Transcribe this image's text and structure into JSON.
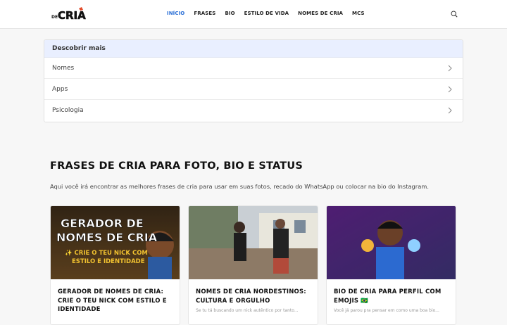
{
  "header": {
    "logo_text": "CRIA",
    "logo_prefix": "DE",
    "nav": [
      {
        "label": "INÍCIO",
        "active": true
      },
      {
        "label": "FRASES",
        "active": false
      },
      {
        "label": "BIO",
        "active": false
      },
      {
        "label": "ESTILO DE VIDA",
        "active": false
      },
      {
        "label": "NOMES DE CRIA",
        "active": false
      },
      {
        "label": "MCS",
        "active": false
      }
    ],
    "search_icon": "search-icon"
  },
  "discover": {
    "heading": "Descobrir mais",
    "items": [
      {
        "label": "Nomes"
      },
      {
        "label": "Apps"
      },
      {
        "label": "Psicologia"
      }
    ]
  },
  "main": {
    "title": "FRASES DE CRIA PARA FOTO, BIO E STATUS",
    "intro": "Aqui você irá encontrar as melhores frases de cria para usar em suas fotos, recado do WhatsApp ou colocar na bio do Instagram."
  },
  "posts": [
    {
      "title": "GERADOR DE NOMES DE CRIA: CRIE O TEU NICK COM ESTILO E IDENTIDADE",
      "thumb_line1": "GERADOR DE",
      "thumb_line2": "NOMES DE CRIA",
      "thumb_line3": "✨ CRIE O TEU NICK COM",
      "thumb_line4": "ESTILO E IDENTIDADE",
      "excerpt": ""
    },
    {
      "title": "NOMES DE CRIA NORDESTINOS: CULTURA E ORGULHO",
      "excerpt": "Se tu tá buscando um nick autêntico por tanto..."
    },
    {
      "title": "BIO DE CRIA PARA PERFIL COM EMOJIS 🇧🇷",
      "excerpt": "Você já parou pra pensar em como uma boa bio..."
    }
  ],
  "colors": {
    "accent": "#2a6fd6",
    "card_head": "#e9efff"
  }
}
